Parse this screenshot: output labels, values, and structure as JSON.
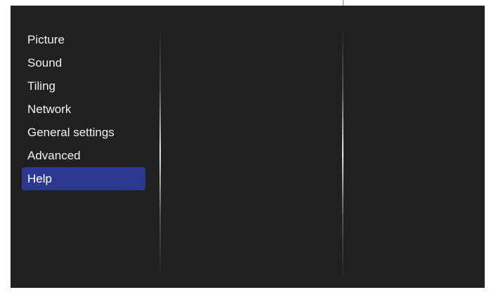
{
  "menu": {
    "items": [
      {
        "label": "Picture"
      },
      {
        "label": "Sound"
      },
      {
        "label": "Tiling"
      },
      {
        "label": "Network"
      },
      {
        "label": "General settings"
      },
      {
        "label": "Advanced"
      },
      {
        "label": "Help"
      }
    ],
    "selected_label": "Help"
  },
  "colors": {
    "background": "#221f20",
    "selected_highlight": "#2b3a90",
    "text": "#f2f2f2"
  }
}
